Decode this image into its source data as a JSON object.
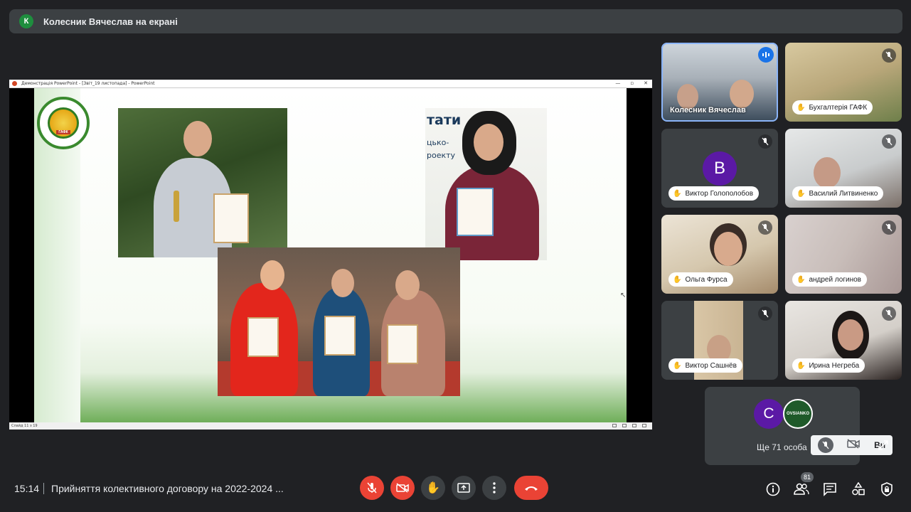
{
  "banner": {
    "avatar_letter": "К",
    "text": "Колесник Вячеслав на екрані"
  },
  "screen": {
    "ppt_title": "Демонстрація PowerPoint - [Звіт_19 листопада] - PowerPoint",
    "status": "Слайд 11 з 19",
    "slide_text": {
      "heading": "тати",
      "line1": "цько-",
      "line2": "роекту",
      "logo_label": "ГАФК"
    }
  },
  "participants": [
    {
      "name": "Колесник Вячеслав",
      "state": "speaking"
    },
    {
      "name": "Бухгалтерія ГАФК",
      "state": "muted"
    },
    {
      "name": "Виктор Голополобов",
      "state": "muted",
      "avatar_letter": "В"
    },
    {
      "name": "Василий Литвиненко",
      "state": "muted"
    },
    {
      "name": "Ольга Фурса",
      "state": "muted"
    },
    {
      "name": "андрей логинов",
      "state": "muted"
    },
    {
      "name": "Виктор Сашнёв",
      "state": "muted"
    },
    {
      "name": "Ирина Негреба",
      "state": "muted"
    }
  ],
  "more": {
    "avatar_letter": "С",
    "logo_text": "OVSIANKO",
    "text": "Ще 71 особа",
    "overlay_label": "Ви"
  },
  "bottom": {
    "time": "15:14",
    "title": "Прийняття колективного договору на 2022-2024 ...",
    "people_count": "81"
  },
  "colors": {
    "accent": "#8ab4f8",
    "danger": "#ea4335",
    "purple_avatar": "#5b19a5",
    "bg": "#202124"
  }
}
